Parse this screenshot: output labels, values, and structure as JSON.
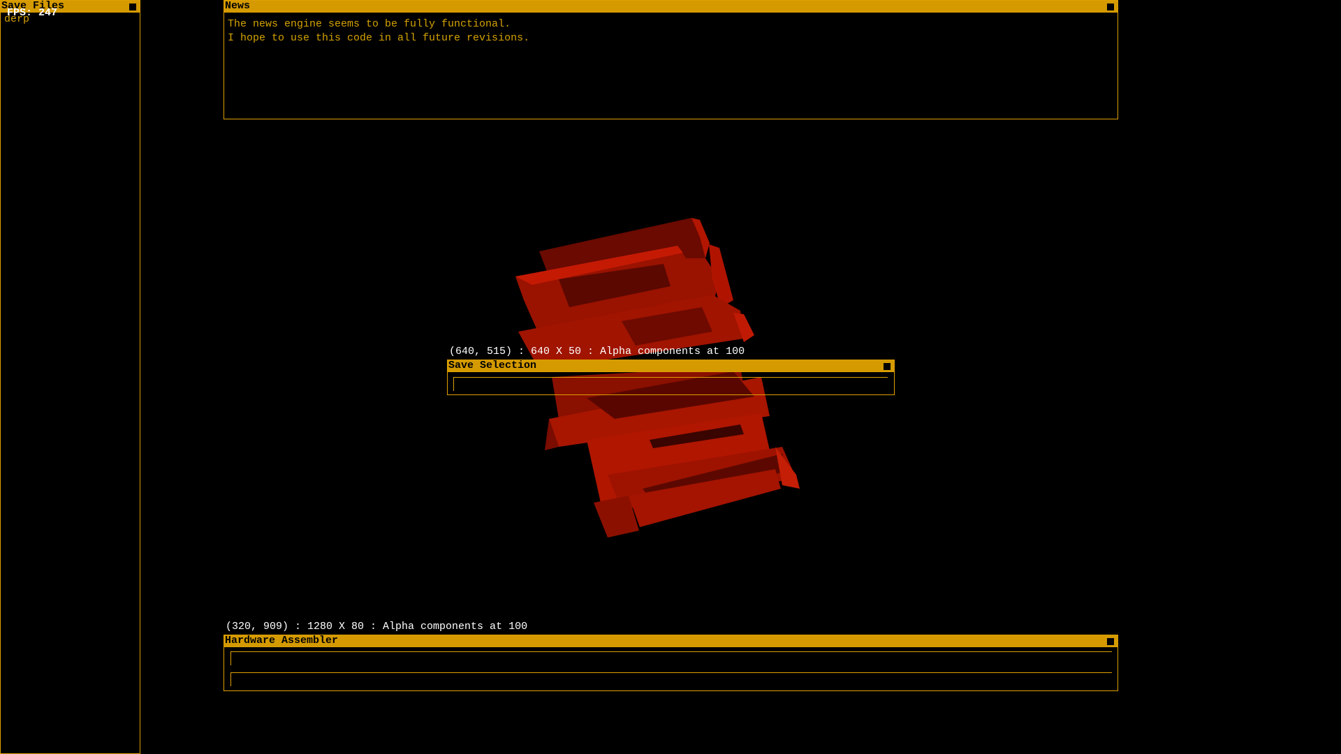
{
  "fps": "FPS: 247",
  "windows": {
    "save_files": {
      "title": "Save Files",
      "items": [
        "derp"
      ]
    },
    "news": {
      "title": "News",
      "lines": [
        "The news engine seems to be fully functional.",
        "I hope to use this code in all future revisions."
      ]
    },
    "save_selection": {
      "info": "(640, 515) : 640 X 50 : Alpha components at 100",
      "title": "Save Selection",
      "input_value": ""
    },
    "hardware_assembler": {
      "info": "(320, 909) : 1280 X 80 : Alpha components at 100",
      "title": "Hardware Assembler",
      "input1_value": "",
      "input2_value": ""
    }
  },
  "colors": {
    "accent": "#d49a00",
    "text_amber": "#d4a200",
    "model_red": "#b01000",
    "background": "#000000"
  },
  "icons": {
    "close": "close-square-icon"
  }
}
